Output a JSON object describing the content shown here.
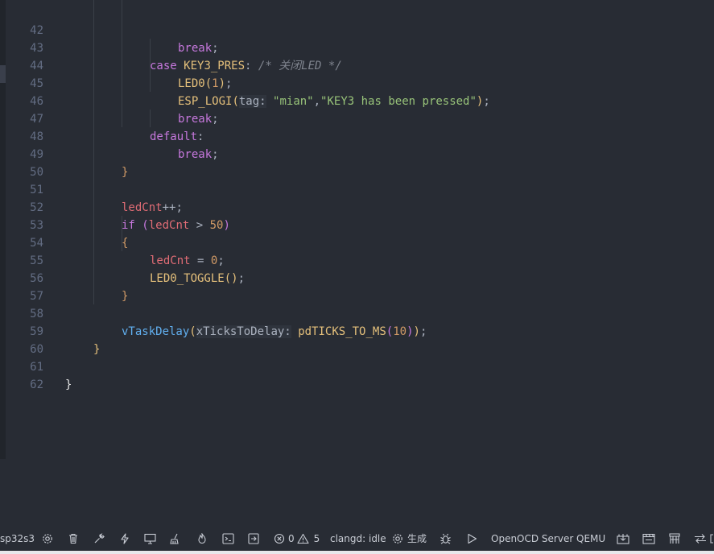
{
  "editor": {
    "lines": [
      {
        "n": "42"
      },
      {
        "n": "43"
      },
      {
        "n": "44"
      },
      {
        "n": "45"
      },
      {
        "n": "46"
      },
      {
        "n": "47"
      },
      {
        "n": "48"
      },
      {
        "n": "49"
      },
      {
        "n": "50"
      },
      {
        "n": "51"
      },
      {
        "n": "52"
      },
      {
        "n": "53"
      },
      {
        "n": "54"
      },
      {
        "n": "55"
      },
      {
        "n": "56"
      },
      {
        "n": "57"
      },
      {
        "n": "58"
      },
      {
        "n": "59"
      },
      {
        "n": "60"
      },
      {
        "n": "61"
      },
      {
        "n": "62"
      }
    ],
    "tokens": {
      "break": "break",
      "semi": ";",
      "case": "case",
      "key3_pres": "KEY3_PRES",
      "colon": ":",
      "comment": "/* 关闭LED */",
      "led0": "LED0",
      "lp": "(",
      "rp": ")",
      "one": "1",
      "esp_logi": "ESP_LOGI",
      "tag_hint": "tag:",
      "mian_str": "\"mian\"",
      "comma": ",",
      "key3_str": "\"KEY3 has been pressed\"",
      "default": "default",
      "rbrace": "}",
      "lbrace": "{",
      "ledcnt": "ledCnt",
      "plusplus": "++",
      "if": "if",
      "gt": " > ",
      "fifty": "50",
      "eq": " = ",
      "zero": "0",
      "led0_toggle": "LED0_TOGGLE",
      "vtaskdelay": "vTaskDelay",
      "xticks_hint": "xTicksToDelay:",
      "pdticks": "pdTICKS_TO_MS",
      "ten": "10"
    }
  },
  "statusbar": {
    "target": "sp32s3",
    "errors": "0",
    "warnings": "5",
    "clangd": "clangd: idle",
    "build_label": "生成",
    "openocd": "OpenOCD Server",
    "qemu": "QEMU",
    "icons": [
      "gear-icon",
      "trash-icon",
      "wrench-icon",
      "flash-icon",
      "monitor-icon",
      "broom-icon",
      "flame-icon",
      "terminal-icon",
      "exit-icon",
      "error-icon",
      "warning-icon",
      "build-gear-icon",
      "bug-icon",
      "run-icon",
      "download-icon",
      "clapper-icon",
      "nuts-icon",
      "swap-icon"
    ]
  }
}
